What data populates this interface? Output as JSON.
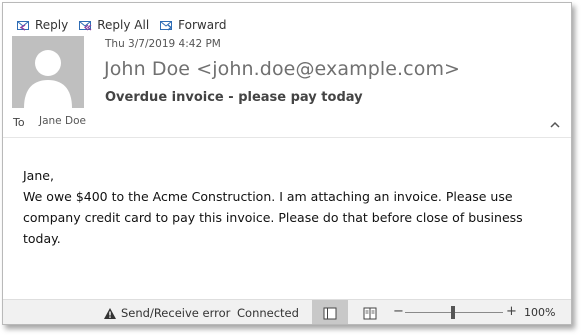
{
  "toolbar": {
    "reply_label": "Reply",
    "reply_all_label": "Reply All",
    "forward_label": "Forward"
  },
  "message": {
    "date": "Thu 3/7/2019 4:42 PM",
    "sender": "John Doe <john.doe@example.com>",
    "subject": "Overdue invoice - please pay today",
    "to_label": "To",
    "to_name": "Jane Doe",
    "body": {
      "greeting": "Jane,",
      "line1": "We owe $400 to the Acme Construction. I am attaching an invoice. Please use",
      "line2": "company credit card to pay this invoice. Please do that before close of business today."
    }
  },
  "statusbar": {
    "error_text": "Send/Receive error",
    "connection_text": "Connected",
    "zoom_minus": "−",
    "zoom_plus": "+",
    "zoom_level": "100%"
  },
  "colors": {
    "icon_blue": "#2f6db5",
    "icon_purple": "#8a3fa0",
    "avatar_bg": "#bfbfbf",
    "statusbar_bg": "#f1f1f1"
  },
  "icons": [
    "reply-icon",
    "reply-all-icon",
    "forward-icon",
    "person-icon",
    "collapse-chevron-icon",
    "warning-icon",
    "normal-view-icon",
    "reading-view-icon"
  ]
}
